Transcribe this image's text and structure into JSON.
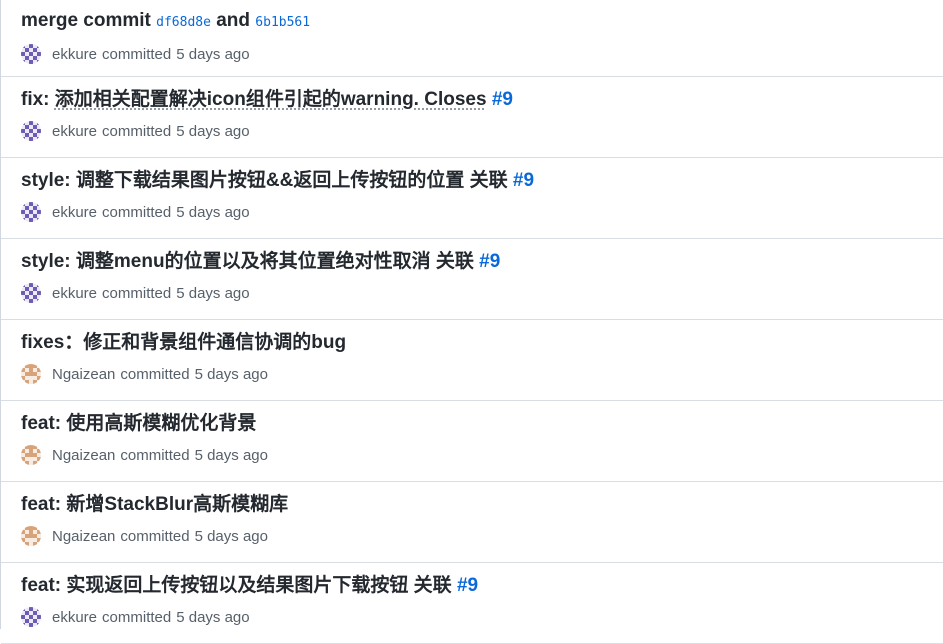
{
  "commits": [
    {
      "title_parts": [
        {
          "type": "msg",
          "text": "merge commit "
        },
        {
          "type": "sha",
          "text": "df68d8e"
        },
        {
          "type": "msg",
          "text": " and "
        },
        {
          "type": "sha",
          "text": "6b1b561"
        }
      ],
      "author": "ekkure",
      "verb": "committed",
      "time": "5 days ago",
      "avatar": "ekkure-avatar"
    },
    {
      "title_parts": [
        {
          "type": "msg",
          "text": "fix: "
        },
        {
          "type": "msg",
          "text": "添加相关配置解决icon组件引起的warning. Closes",
          "dotted": true
        },
        {
          "type": "msg",
          "text": " "
        },
        {
          "type": "link",
          "text": "#9"
        }
      ],
      "author": "ekkure",
      "verb": "committed",
      "time": "5 days ago",
      "avatar": "ekkure-avatar"
    },
    {
      "title_parts": [
        {
          "type": "msg",
          "text": "style: 调整下载结果图片按钮&&返回上传按钮的位置 关联 "
        },
        {
          "type": "link",
          "text": "#9"
        }
      ],
      "author": "ekkure",
      "verb": "committed",
      "time": "5 days ago",
      "avatar": "ekkure-avatar"
    },
    {
      "title_parts": [
        {
          "type": "msg",
          "text": "style: 调整menu的位置以及将其位置绝对性取消 关联 "
        },
        {
          "type": "link",
          "text": "#9"
        }
      ],
      "author": "ekkure",
      "verb": "committed",
      "time": "5 days ago",
      "avatar": "ekkure-avatar"
    },
    {
      "title_parts": [
        {
          "type": "msg",
          "text": "fixes：修正和背景组件通信协调的bug"
        }
      ],
      "author": "Ngaizean",
      "verb": "committed",
      "time": "5 days ago",
      "avatar": "ngaizean-avatar"
    },
    {
      "title_parts": [
        {
          "type": "msg",
          "text": "feat: 使用高斯模糊优化背景"
        }
      ],
      "author": "Ngaizean",
      "verb": "committed",
      "time": "5 days ago",
      "avatar": "ngaizean-avatar"
    },
    {
      "title_parts": [
        {
          "type": "msg",
          "text": "feat: 新增StackBlur高斯模糊库"
        }
      ],
      "author": "Ngaizean",
      "verb": "committed",
      "time": "5 days ago",
      "avatar": "ngaizean-avatar"
    },
    {
      "title_parts": [
        {
          "type": "msg",
          "text": "feat: 实现返回上传按钮以及结果图片下载按钮 关联 "
        },
        {
          "type": "link",
          "text": "#9"
        }
      ],
      "author": "ekkure",
      "verb": "committed",
      "time": "5 days ago",
      "avatar": "ekkure-avatar"
    }
  ],
  "colors": {
    "link": "#0969da",
    "text": "#24292f",
    "muted": "#57606a",
    "ekkure_avatar": "#6e5bb5",
    "ngaizean_avatar": "#d9a37a"
  }
}
